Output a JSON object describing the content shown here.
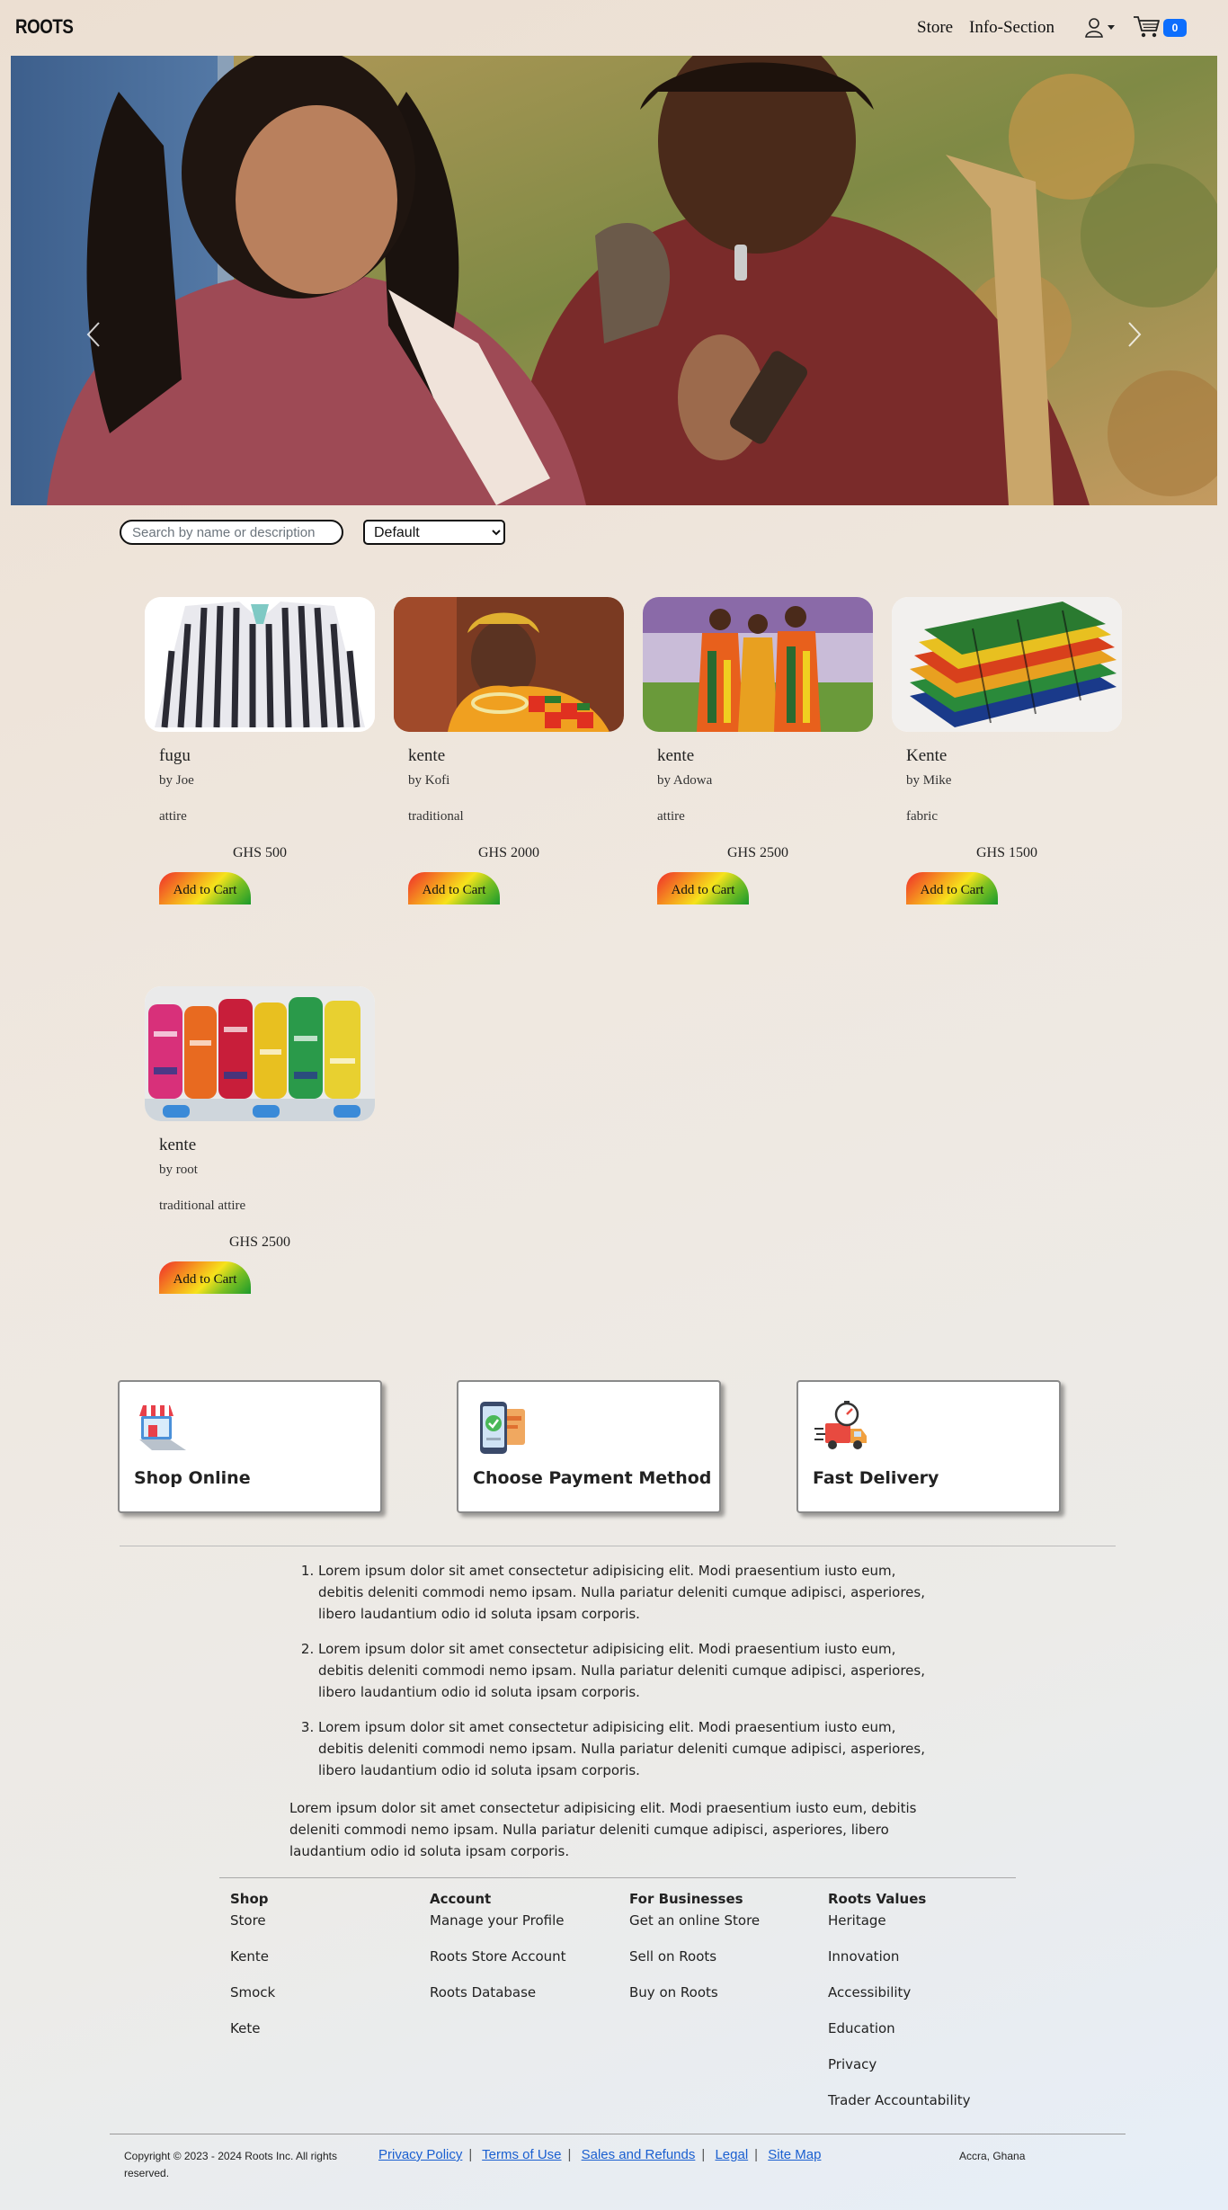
{
  "nav": {
    "brand": "ROOTS",
    "links": [
      "Store",
      "Info-Section"
    ],
    "cart_count": "0"
  },
  "hero": {
    "icons": {
      "prev": "chevron-left-icon",
      "next": "chevron-right-icon"
    }
  },
  "controls": {
    "search_placeholder": "Search by name or description",
    "sort_selected": "Default"
  },
  "products": [
    {
      "name": "fugu",
      "seller": "by Joe",
      "category": "attire",
      "price": "GHS 500",
      "button": "Add to Cart"
    },
    {
      "name": "kente",
      "seller": "by Kofi",
      "category": "traditional",
      "price": "GHS 2000",
      "button": "Add to Cart"
    },
    {
      "name": "kente",
      "seller": "by Adowa",
      "category": "attire",
      "price": "GHS 2500",
      "button": "Add to Cart"
    },
    {
      "name": "Kente",
      "seller": "by Mike",
      "category": "fabric",
      "price": "GHS 1500",
      "button": "Add to Cart"
    },
    {
      "name": "kente",
      "seller": "by root",
      "category": "traditional attire",
      "price": "GHS 2500",
      "button": "Add to Cart"
    }
  ],
  "features": [
    {
      "title": "Shop Online",
      "icon": "shop-laptop-icon"
    },
    {
      "title": "Choose Payment Method",
      "icon": "phone-payment-icon"
    },
    {
      "title": "Fast Delivery",
      "icon": "delivery-truck-icon"
    }
  ],
  "info": {
    "list": [
      "Lorem ipsum dolor sit amet consectetur adipisicing elit. Modi praesentium iusto eum, debitis deleniti commodi nemo ipsam. Nulla pariatur deleniti cumque adipisci, asperiores, libero laudantium odio id soluta ipsam corporis.",
      "Lorem ipsum dolor sit amet consectetur adipisicing elit. Modi praesentium iusto eum, debitis deleniti commodi nemo ipsam. Nulla pariatur deleniti cumque adipisci, asperiores, libero laudantium odio id soluta ipsam corporis.",
      "Lorem ipsum dolor sit amet consectetur adipisicing elit. Modi praesentium iusto eum, debitis deleniti commodi nemo ipsam. Nulla pariatur deleniti cumque adipisci, asperiores, libero laudantium odio id soluta ipsam corporis."
    ],
    "paragraph": "Lorem ipsum dolor sit amet consectetur adipisicing elit. Modi praesentium iusto eum, debitis deleniti commodi nemo ipsam. Nulla pariatur deleniti cumque adipisci, asperiores, libero laudantium odio id soluta ipsam corporis."
  },
  "footer": {
    "columns": [
      {
        "heading": "Shop",
        "links": [
          "Store",
          "Kente",
          "Smock",
          "Kete"
        ]
      },
      {
        "heading": "Account",
        "links": [
          "Manage your Profile",
          "Roots Store Account",
          "Roots Database"
        ]
      },
      {
        "heading": "For Businesses",
        "links": [
          "Get an online Store",
          "Sell on Roots",
          "Buy on Roots"
        ]
      },
      {
        "heading": "Roots Values",
        "links": [
          "Heritage",
          "Innovation",
          "Accessibility",
          "Education",
          "Privacy",
          "Trader Accountability"
        ]
      }
    ],
    "copyright": "Copyright © 2023 - 2024 Roots Inc. All rights reserved.",
    "legal_links": [
      "Privacy Policy",
      "Terms of Use",
      "Sales and Refunds",
      "Legal",
      "Site Map"
    ],
    "location": "Accra, Ghana"
  }
}
